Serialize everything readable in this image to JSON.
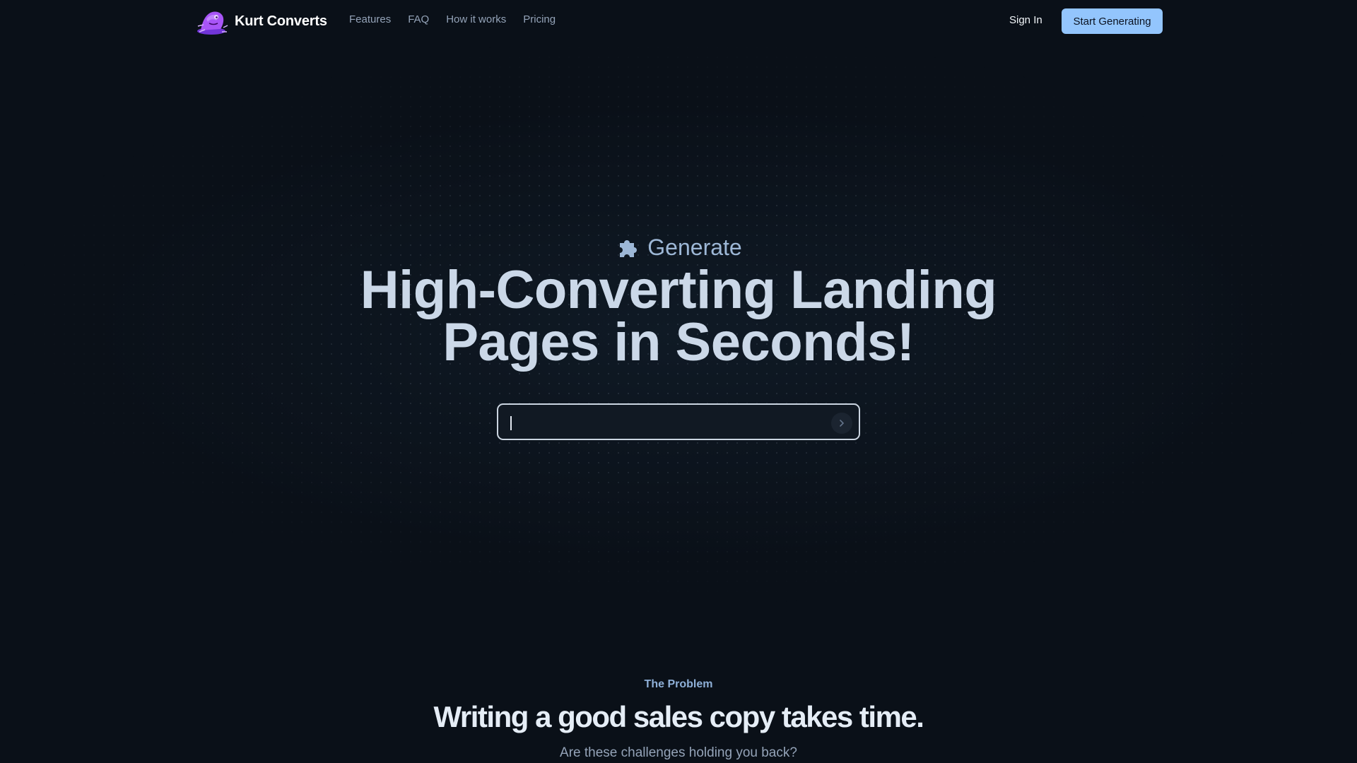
{
  "header": {
    "brand": "Kurt Converts",
    "nav": [
      "Features",
      "FAQ",
      "How it works",
      "Pricing"
    ],
    "sign_in": "Sign In",
    "cta": "Start Generating"
  },
  "hero": {
    "eyebrow_icon": "puzzle-icon",
    "eyebrow": "Generate",
    "title_line1": "High-Converting Landing",
    "title_line2": "Pages in Seconds!",
    "input_value": "",
    "submit_icon": "chevron-right-icon"
  },
  "problem": {
    "label": "The Problem",
    "title": "Writing a good sales copy takes time.",
    "subtitle": "Are these challenges holding you back?"
  },
  "colors": {
    "background": "#0a1018",
    "accent": "#93c5fd",
    "logo": "#a855f7"
  }
}
